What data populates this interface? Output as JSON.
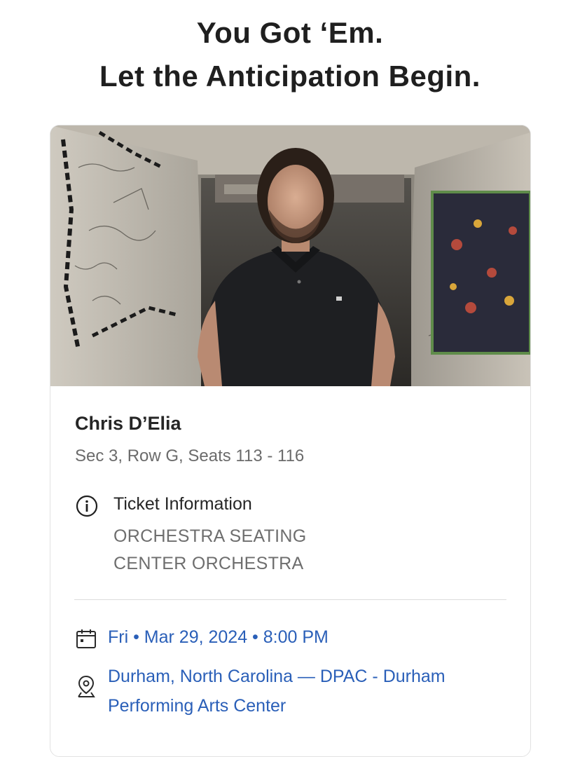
{
  "header": {
    "line1": "You Got ‘Em.",
    "line2": "Let the Anticipation Begin."
  },
  "event": {
    "performer": "Chris D’Elia",
    "seats": "Sec 3, Row G, Seats 113 - 116",
    "ticket_info_title": "Ticket Information",
    "ticket_info_lines": [
      "ORCHESTRA SEATING",
      "CENTER ORCHESTRA"
    ],
    "datetime": "Fri • Mar 29, 2024 • 8:00 PM",
    "venue": "Durham, North Carolina — DPAC - Durham Performing Arts Center"
  },
  "icons": {
    "info": "info-icon",
    "calendar": "calendar-icon",
    "location": "location-pin-icon"
  },
  "colors": {
    "link": "#2a5fb8",
    "muted": "#6b6b6b"
  }
}
